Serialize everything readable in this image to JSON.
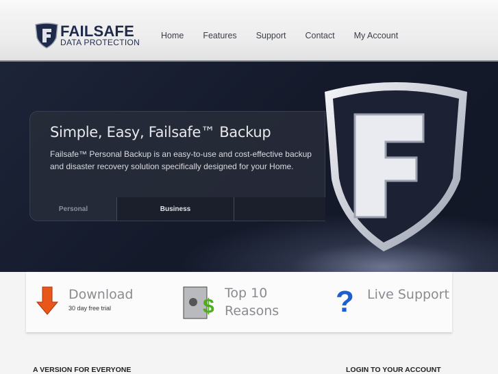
{
  "header": {
    "logo_main": "FAILSAFE",
    "logo_sub": "DATA PROTECTION",
    "nav": [
      "Home",
      "Features",
      "Support",
      "Contact",
      "My Account"
    ]
  },
  "hero": {
    "title": "Simple, Easy, Failsafe™ Backup",
    "description": "Failsafe™ Personal Backup is an easy-to-use and cost-effective backup and disaster recovery solution specifically designed for your Home.",
    "tabs": [
      "Personal",
      "Business",
      ""
    ]
  },
  "features": [
    {
      "title": "Download",
      "subtitle": "30 day free trial"
    },
    {
      "title": "Top 10 Reasons"
    },
    {
      "title": "Live Support"
    }
  ],
  "sections": {
    "left": "A VERSION FOR EVERYONE",
    "right": "LOGIN TO YOUR ACCOUNT"
  }
}
